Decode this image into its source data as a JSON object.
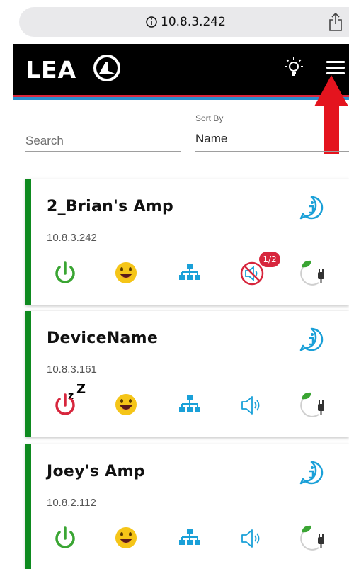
{
  "browser": {
    "url": "10.8.3.242"
  },
  "header": {
    "logo_text": "LEA",
    "colors": {
      "background": "#000000",
      "stripe_red": "#d9263b",
      "stripe_blue": "#2a8fcf"
    }
  },
  "controls": {
    "search_placeholder": "Search",
    "sort_label": "Sort By",
    "sort_value": "Name"
  },
  "devices": [
    {
      "name": "2_Brian's Amp",
      "ip": "10.8.3.242",
      "power_state": "on",
      "speaker_state": "muted",
      "speaker_badge": "1/2"
    },
    {
      "name": "DeviceName",
      "ip": "10.8.3.161",
      "power_state": "standby",
      "speaker_state": "normal"
    },
    {
      "name": "Joey's Amp",
      "ip": "10.8.2.112",
      "power_state": "on",
      "speaker_state": "normal"
    }
  ],
  "icons": [
    "info-icon",
    "power-icon",
    "smiley-icon",
    "network-icon",
    "speaker-icon",
    "eco-plug-icon",
    "bulb-icon",
    "hamburger-menu-icon",
    "share-icon"
  ],
  "colors": {
    "card_accent": "#0e8a1f",
    "power_on": "#3aa533",
    "power_standby": "#d7263d",
    "accent_blue": "#1aa0d8",
    "smiley": "#f5c518",
    "muted_red": "#d7263d",
    "annotation_arrow": "#e4141e"
  }
}
